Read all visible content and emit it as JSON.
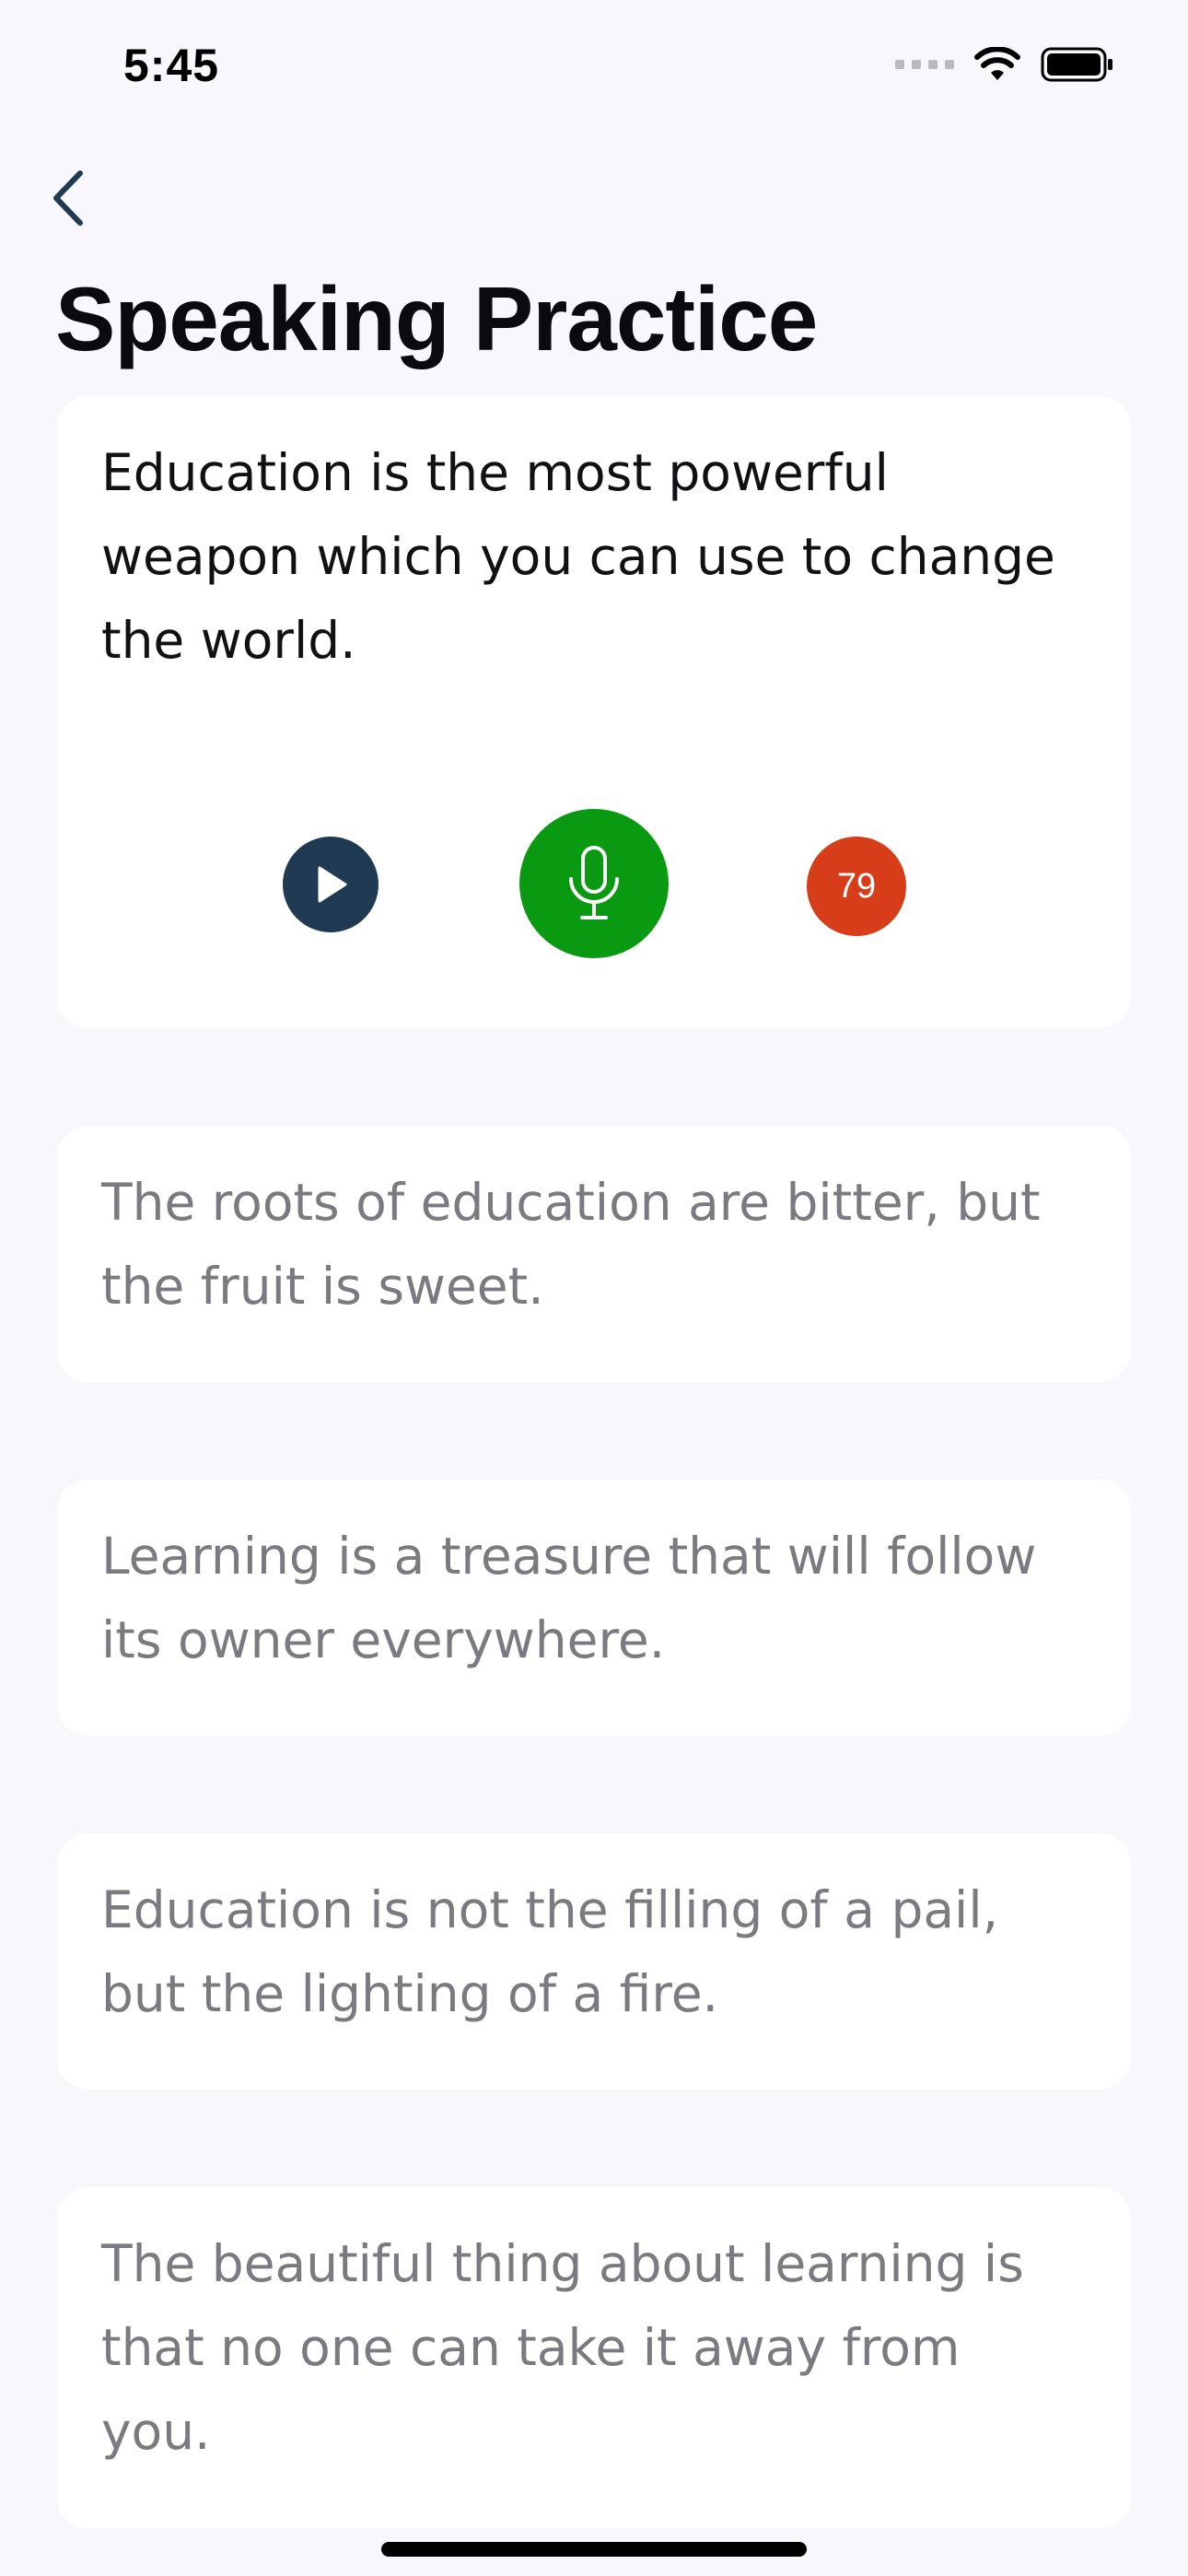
{
  "status_bar": {
    "time": "5:45",
    "icons": [
      "cellular-signal-icon",
      "wifi-icon",
      "battery-icon"
    ]
  },
  "nav": {
    "back_icon": "chevron-left-icon"
  },
  "page": {
    "title": "Speaking Practice"
  },
  "active_card": {
    "text": "Education is the most powerful weapon which you can use to change the world.",
    "controls": {
      "play_icon": "play-icon",
      "mic_icon": "microphone-icon",
      "score": "79"
    }
  },
  "cards": [
    {
      "text": "The roots of education are bitter, but the fruit is sweet."
    },
    {
      "text": "Learning is a treasure that will follow its owner everywhere."
    },
    {
      "text": "Education is not the filling of a pail, but the lighting of a fire."
    },
    {
      "text": "The beautiful thing about learning is that no one can take it away from you."
    }
  ],
  "colors": {
    "background": "#F8F8FC",
    "card": "#FFFFFF",
    "play_button": "#1F3A52",
    "mic_button": "#0A9A12",
    "score_badge": "#D83D1A",
    "inactive_text": "#7A7A80"
  }
}
